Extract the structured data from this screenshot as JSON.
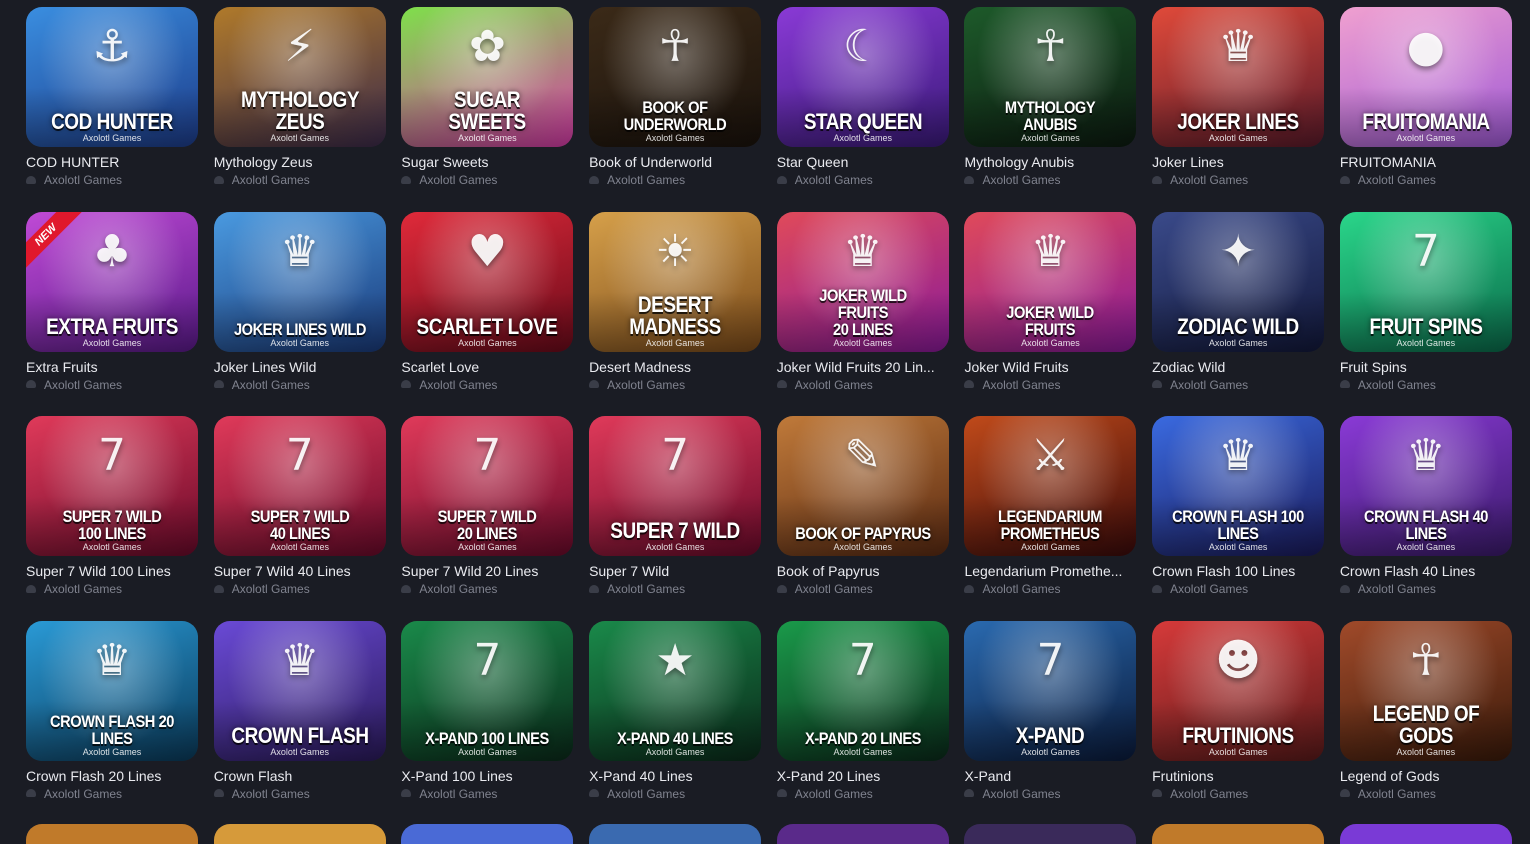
{
  "provider_label": "Axolotl Games",
  "games": [
    {
      "name": "COD HUNTER",
      "art_title": "COD HUNTER",
      "emblem": "⚓",
      "bg": [
        "#3a8ee0",
        "#1d3c8a"
      ]
    },
    {
      "name": "Mythology Zeus",
      "art_title": "MYTHOLOGY\nZEUS",
      "emblem": "⚡",
      "bg": [
        "#b07a2a",
        "#3b2a4a"
      ]
    },
    {
      "name": "Sugar Sweets",
      "art_title": "SUGAR SWEETS",
      "emblem": "✿",
      "bg": [
        "#7ee04a",
        "#d63aa8"
      ]
    },
    {
      "name": "Book of Underworld",
      "art_title": "BOOK OF\nUNDERWORLD",
      "emblem": "☥",
      "bg": [
        "#3b2a18",
        "#1a120c"
      ]
    },
    {
      "name": "Star Queen",
      "art_title": "STAR QUEEN",
      "emblem": "☾",
      "bg": [
        "#8a3ad6",
        "#3a1a7a"
      ]
    },
    {
      "name": "Mythology Anubis",
      "art_title": "MYTHOLOGY ANUBIS",
      "emblem": "☥",
      "bg": [
        "#1d5a2a",
        "#0c1a10"
      ]
    },
    {
      "name": "Joker Lines",
      "art_title": "JOKER LINES",
      "emblem": "♛",
      "bg": [
        "#e04a3a",
        "#5a1a2a"
      ]
    },
    {
      "name": "FRUITOMANIA",
      "art_title": "FRUITOMANIA",
      "emblem": "●",
      "bg": [
        "#f0a0d0",
        "#a05ad6"
      ]
    },
    {
      "name": "Extra Fruits",
      "art_title": "EXTRA FRUITS",
      "emblem": "♣",
      "bg": [
        "#c04ad6",
        "#5a1a8a"
      ],
      "badge": "NEW"
    },
    {
      "name": "Joker Lines Wild",
      "art_title": "JOKER LINES WILD",
      "emblem": "♛",
      "bg": [
        "#4a9ae0",
        "#1a3a7a"
      ]
    },
    {
      "name": "Scarlet Love",
      "art_title": "SCARLET LOVE",
      "emblem": "♥",
      "bg": [
        "#e02a3a",
        "#6a0a1a"
      ]
    },
    {
      "name": "Desert Madness",
      "art_title": "DESERT MADNESS",
      "emblem": "☀",
      "bg": [
        "#d6a04a",
        "#7a4a1a"
      ]
    },
    {
      "name": "Joker Wild Fruits 20 Lin...",
      "art_title": "JOKER WILD FRUITS\n20 LINES",
      "emblem": "♛",
      "bg": [
        "#e04a5a",
        "#8a1a9a"
      ]
    },
    {
      "name": "Joker Wild Fruits",
      "art_title": "JOKER WILD FRUITS",
      "emblem": "♛",
      "bg": [
        "#e04a5a",
        "#8a1a9a"
      ]
    },
    {
      "name": "Zodiac Wild",
      "art_title": "ZODIAC WILD",
      "emblem": "✦",
      "bg": [
        "#3a4a8a",
        "#12183a"
      ]
    },
    {
      "name": "Fruit Spins",
      "art_title": "FRUIT SPINS",
      "emblem": "7",
      "bg": [
        "#2ad68a",
        "#0a6a4a"
      ]
    },
    {
      "name": "Super 7 Wild 100 Lines",
      "art_title": "SUPER 7 WILD\n100 LINES",
      "emblem": "7",
      "bg": [
        "#e03a5a",
        "#6a0a2a"
      ]
    },
    {
      "name": "Super 7 Wild 40 Lines",
      "art_title": "SUPER 7 WILD\n40 LINES",
      "emblem": "7",
      "bg": [
        "#e03a5a",
        "#6a0a2a"
      ]
    },
    {
      "name": "Super 7 Wild 20 Lines",
      "art_title": "SUPER 7 WILD\n20 LINES",
      "emblem": "7",
      "bg": [
        "#e03a5a",
        "#6a0a2a"
      ]
    },
    {
      "name": "Super 7 Wild",
      "art_title": "SUPER 7 WILD",
      "emblem": "7",
      "bg": [
        "#e03a5a",
        "#6a0a2a"
      ]
    },
    {
      "name": "Book of Papyrus",
      "art_title": "BOOK OF PAPYRUS",
      "emblem": "✎",
      "bg": [
        "#c07a3a",
        "#5a2a12"
      ]
    },
    {
      "name": "Legendarium Promethe...",
      "art_title": "LEGENDARIUM PROMETHEUS",
      "emblem": "⚔",
      "bg": [
        "#c04a1a",
        "#3a0a0a"
      ]
    },
    {
      "name": "Crown Flash 100 Lines",
      "art_title": "CROWN FLASH 100 LINES",
      "emblem": "♛",
      "bg": [
        "#3a6ae0",
        "#1a1a5a"
      ]
    },
    {
      "name": "Crown Flash 40 Lines",
      "art_title": "CROWN FLASH 40 LINES",
      "emblem": "♛",
      "bg": [
        "#8a3ad6",
        "#3a1a6a"
      ]
    },
    {
      "name": "Crown Flash 20 Lines",
      "art_title": "CROWN FLASH 20 LINES",
      "emblem": "♛",
      "bg": [
        "#2a9ad6",
        "#0a3a5a"
      ]
    },
    {
      "name": "Crown Flash",
      "art_title": "CROWN FLASH",
      "emblem": "♛",
      "bg": [
        "#6a4ad6",
        "#2a1a5a"
      ]
    },
    {
      "name": "X-Pand 100 Lines",
      "art_title": "X-PAND 100 LINES",
      "emblem": "7",
      "bg": [
        "#1a8a4a",
        "#0a2a1a"
      ]
    },
    {
      "name": "X-Pand 40 Lines",
      "art_title": "X-PAND 40 LINES",
      "emblem": "★",
      "bg": [
        "#1a8a4a",
        "#0a2a1a"
      ]
    },
    {
      "name": "X-Pand 20 Lines",
      "art_title": "X-PAND 20 LINES",
      "emblem": "7",
      "bg": [
        "#1a9a4a",
        "#0a2a1a"
      ]
    },
    {
      "name": "X-Pand",
      "art_title": "X-PAND",
      "emblem": "7",
      "bg": [
        "#2a6ab0",
        "#0a1a3a"
      ]
    },
    {
      "name": "Frutinions",
      "art_title": "FRUTINIONS",
      "emblem": "☻",
      "bg": [
        "#d63a3a",
        "#5a1a1a"
      ]
    },
    {
      "name": "Legend of Gods",
      "art_title": "LEGEND OF GODS",
      "emblem": "☥",
      "bg": [
        "#a04a2a",
        "#3a1a0a"
      ]
    }
  ],
  "peek_colors": [
    "#c07a2a",
    "#d69a3a",
    "#4a6ad6",
    "#3a6ab0",
    "#5a2a8a",
    "#3a2a5a",
    "#c07a2a",
    "#7a3ad6"
  ]
}
